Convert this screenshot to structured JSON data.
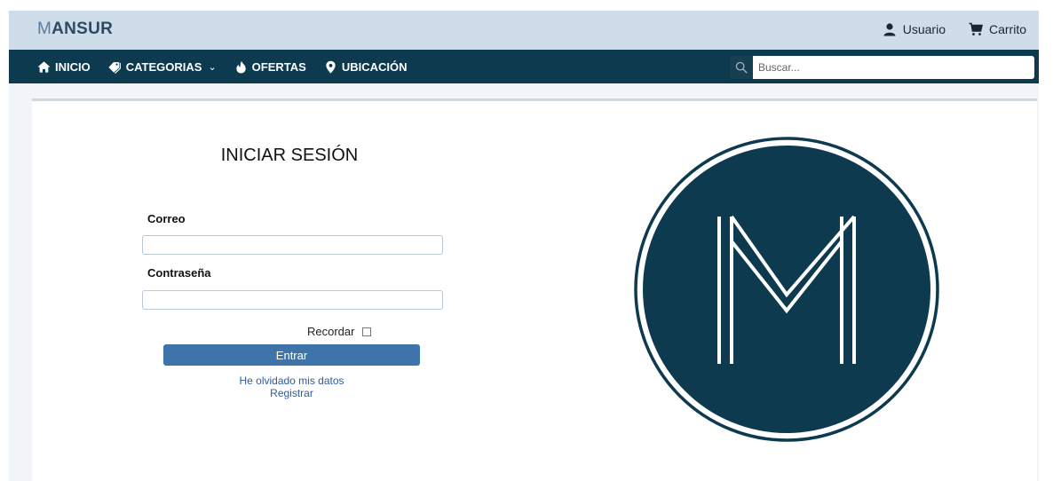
{
  "brand": {
    "prefix": "M",
    "rest": "ANSUR"
  },
  "top_links": {
    "user": "Usuario",
    "cart": "Carrito"
  },
  "nav": {
    "home": "INICIO",
    "categories": "CATEGORIAS",
    "offers": "OFERTAS",
    "location": "UBICACIÓN"
  },
  "search": {
    "placeholder": "Buscar..."
  },
  "login": {
    "title": "INICIAR SESIÓN",
    "email_label": "Correo",
    "email_value": "",
    "password_label": "Contraseña",
    "password_value": "",
    "remember_label": "Recordar",
    "remember_checked": false,
    "submit_label": "Entrar",
    "forgot_link": "He olvidado mis datos",
    "register_link": "Registrar"
  },
  "colors": {
    "topbar": "#cfdcea",
    "navbar": "#0e3a4f",
    "accent": "#3f74aa",
    "logo_fill": "#0e3a4f"
  },
  "icons": [
    "user-icon",
    "cart-icon",
    "home-icon",
    "tag-icon",
    "fire-icon",
    "map-marker-icon",
    "search-icon",
    "m-logo"
  ]
}
